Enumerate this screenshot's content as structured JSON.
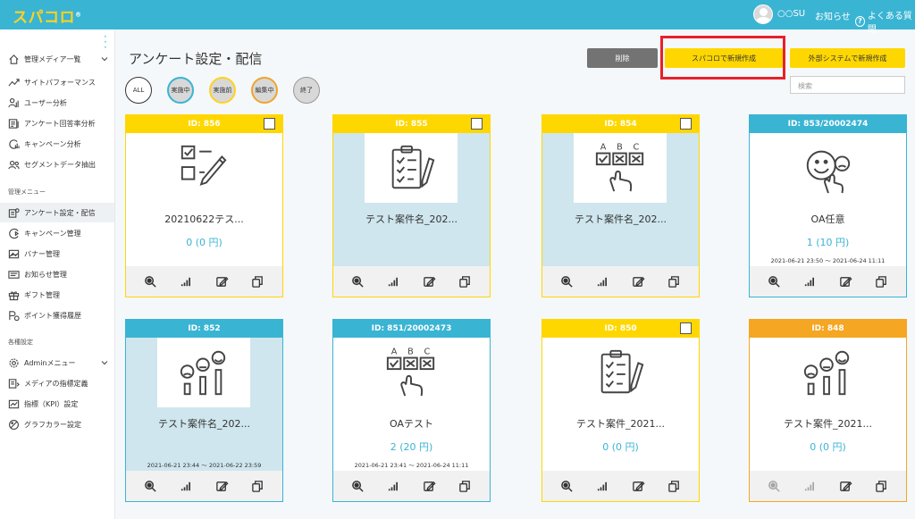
{
  "header": {
    "logo": "スパコロ",
    "logo_mark": "®",
    "user": "○○SU",
    "notice": "お知らせ",
    "help": "よくある質問",
    "help_icon": "?"
  },
  "sidebar": {
    "menu": [
      {
        "label": "管理メディア一覧",
        "icon": "home-icon"
      },
      {
        "label": "サイトパフォーマンス",
        "icon": "trend-icon"
      },
      {
        "label": "ユーザー分析",
        "icon": "user-analysis-icon"
      },
      {
        "label": "アンケート回答率分析",
        "icon": "survey-rate-icon"
      },
      {
        "label": "キャンペーン分析",
        "icon": "campaign-analysis-icon"
      },
      {
        "label": "セグメントデータ抽出",
        "icon": "segment-icon"
      }
    ],
    "section_manage": "管理メニュー",
    "manage": [
      {
        "label": "アンケート設定・配信",
        "icon": "survey-settings-icon"
      },
      {
        "label": "キャンペーン管理",
        "icon": "campaign-icon"
      },
      {
        "label": "バナー管理",
        "icon": "banner-icon"
      },
      {
        "label": "お知らせ管理",
        "icon": "notice-icon"
      },
      {
        "label": "ギフト管理",
        "icon": "gift-icon"
      },
      {
        "label": "ポイント獲得履歴",
        "icon": "points-icon"
      }
    ],
    "section_settings": "各種設定",
    "settings": [
      {
        "label": "Adminメニュー",
        "icon": "gear-icon"
      },
      {
        "label": "メディアの指標定義",
        "icon": "media-def-icon"
      },
      {
        "label": "指標（KPI）設定",
        "icon": "kpi-icon"
      },
      {
        "label": "グラフカラー設定",
        "icon": "palette-icon"
      }
    ]
  },
  "main": {
    "title": "アンケート設定・配信",
    "delete_label": "削除",
    "new_label": "スパコロで新規作成",
    "external_label": "外部システムで新規作成",
    "search_placeholder": "検索",
    "filters": [
      "ALL",
      "実施中",
      "実施前",
      "編集中",
      "終了"
    ]
  },
  "cards": [
    {
      "id": "ID: 856",
      "name": "20210622テス...",
      "count": "0 (0 円)",
      "dates": "",
      "status": "実施前",
      "color": "#ffd700",
      "thumb": "checklist-pencil-icon",
      "checkbox": true
    },
    {
      "id": "ID: 855",
      "name": "テスト案件名_202...",
      "count": "",
      "dates": "",
      "status": "実施前",
      "color": "#ffd700",
      "thumb": "clipboard-checklist-icon",
      "checkbox": true
    },
    {
      "id": "ID: 854",
      "name": "テスト案件名_202...",
      "count": "",
      "dates": "",
      "status": "実施前",
      "color": "#ffd700",
      "thumb": "abc-choice-icon",
      "checkbox": true
    },
    {
      "id": "ID: 853/20002474",
      "name": "OA任意",
      "count": "1 (10 円)",
      "dates": "2021-06-21 23:50 〜 2021-06-24 11:11",
      "status": "実施中",
      "color": "#3ab4d3",
      "thumb": "smiley-rating-icon",
      "checkbox": false
    },
    {
      "id": "ID: 852",
      "name": "テスト案件名_202...",
      "count": "",
      "dates": "2021-06-21 23:44 〜 2021-06-22 23:59",
      "status": "実施中",
      "color": "#3ab4d3",
      "thumb": "face-rating-bars-icon",
      "checkbox": false
    },
    {
      "id": "ID: 851/20002473",
      "name": "OAテスト",
      "count": "2 (20 円)",
      "dates": "2021-06-21 23:41 〜 2021-06-24 11:11",
      "status": "実施中",
      "color": "#3ab4d3",
      "thumb": "abc-choice-icon",
      "checkbox": false
    },
    {
      "id": "ID: 850",
      "name": "テスト案件_2021...",
      "count": "0 (0 円)",
      "dates": "",
      "status": "実施前",
      "color": "#ffd700",
      "thumb": "clipboard-checklist-icon",
      "checkbox": true
    },
    {
      "id": "ID: 848",
      "name": "テスト案件_2021...",
      "count": "0 (0 円)",
      "dates": "",
      "status": "編集中",
      "color": "#f5a623",
      "thumb": "face-rating-bars-icon",
      "checkbox": false
    }
  ],
  "card_actions": [
    "preview-icon",
    "stats-icon",
    "edit-icon",
    "copy-icon"
  ],
  "colors": {
    "header": "#3ab4d3",
    "accent_yellow": "#ffd700",
    "accent_blue": "#3ab4d3",
    "accent_orange": "#f5a623",
    "highlight_red": "#e8202a"
  }
}
